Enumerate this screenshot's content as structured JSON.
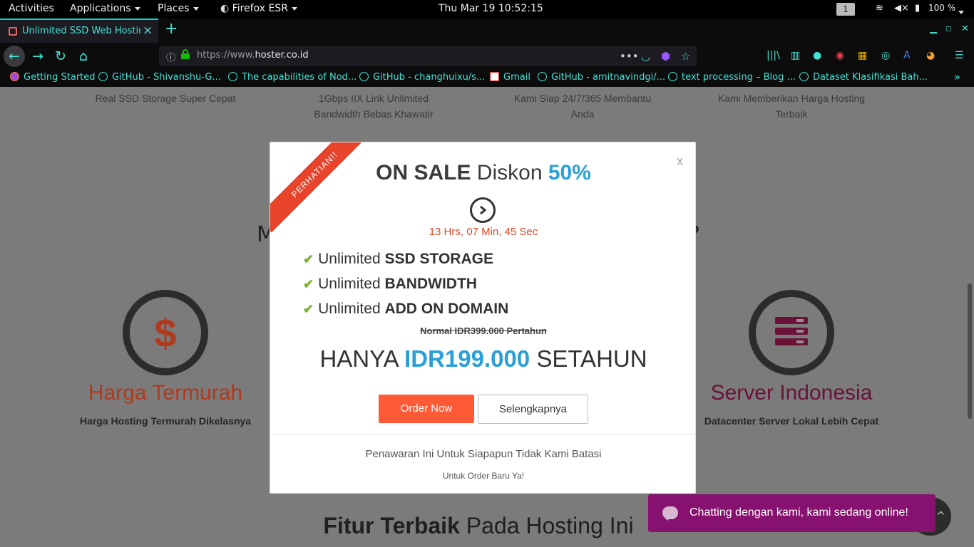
{
  "system_bar": {
    "activities": "Activities",
    "applications": "Applications",
    "places": "Places",
    "app_name": "Firefox ESR",
    "datetime": "Thu Mar 19  10:52:15",
    "workspace": "1",
    "battery": "100 %"
  },
  "browser": {
    "tab_title": "Unlimited SSD Web Hosting",
    "url_prefix": "https://www.",
    "url_host": "hoster.co.id",
    "bookmarks": [
      "Getting Started",
      "GitHub - Shivanshu-G...",
      "The capabilities of Nod...",
      "GitHub - changhuixu/s...",
      "Gmail",
      "GitHub - amitnavindgi/...",
      "text processing – Blog ...",
      "Dataset Klasifikasi Bah..."
    ],
    "accent_color": "#46e1d4"
  },
  "page": {
    "feature_captions": [
      "Real SSD Storage Super Cepat",
      "1Gbps IIX Link Unlimited Bandwidth Bebas Khawatir",
      "Kami Siap 24/7/365 Membantu Anda",
      "Kami Memberikan Harga Hosting Terbaik"
    ],
    "heading_frag_left": "M",
    "heading_frag_right": "?",
    "card_left": {
      "symbol": "$",
      "title": "Harga Termurah",
      "subtitle": "Harga Hosting Termurah Dikelasnya",
      "color": "#b03a1d"
    },
    "card_right": {
      "title": "Server Indonesia",
      "subtitle": "Datacenter Server Lokal Lebih Cepat",
      "color": "#6b1238"
    },
    "bottom_heading_bold": "Fitur Terbaik",
    "bottom_heading_rest": " Pada Hosting Ini"
  },
  "modal": {
    "ribbon": "PERHATIAN!!",
    "close": "x",
    "sale_bold": "ON SALE",
    "sale_text": " Diskon ",
    "sale_pct": "50%",
    "timer": "13 Hrs, 07 Min, 45 Sec",
    "features": [
      {
        "prefix": "Unlimited ",
        "bold": "SSD STORAGE"
      },
      {
        "prefix": "Unlimited ",
        "bold": "BANDWIDTH"
      },
      {
        "prefix": "Unlimited ",
        "bold": "ADD ON DOMAIN"
      }
    ],
    "normal_price": "Normal IDR399.000 Pertahun",
    "price_prefix": "HANYA ",
    "price_amount": "IDR199.000",
    "price_suffix": " SETAHUN",
    "order_button": "Order Now",
    "more_button": "Selengkapnya",
    "offer_line1": "Penawaran Ini Untuk Siapapun Tidak Kami Batasi",
    "offer_line2": "Untuk Order Baru Ya!",
    "accent_blue": "#2a9fd8",
    "accent_orange": "#ff5a35"
  },
  "chat": {
    "text": "Chatting dengan kami, kami sedang online!",
    "color": "#86116e"
  }
}
